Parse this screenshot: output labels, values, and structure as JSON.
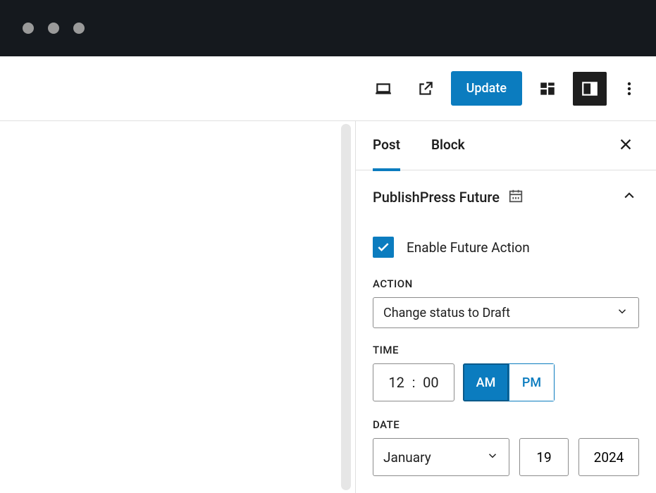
{
  "toolbar": {
    "update_label": "Update"
  },
  "sidebar": {
    "tabs": {
      "post": "Post",
      "block": "Block"
    },
    "panel_title": "PublishPress Future",
    "enable_label": "Enable Future Action",
    "action_label": "Action",
    "action_value": "Change status to Draft",
    "time_label": "Time",
    "time_hour": "12",
    "time_minute": "00",
    "am_label": "AM",
    "pm_label": "PM",
    "date_label": "Date",
    "month_value": "January",
    "day_value": "19",
    "year_value": "2024"
  },
  "colors": {
    "accent": "#0b7cbf"
  }
}
